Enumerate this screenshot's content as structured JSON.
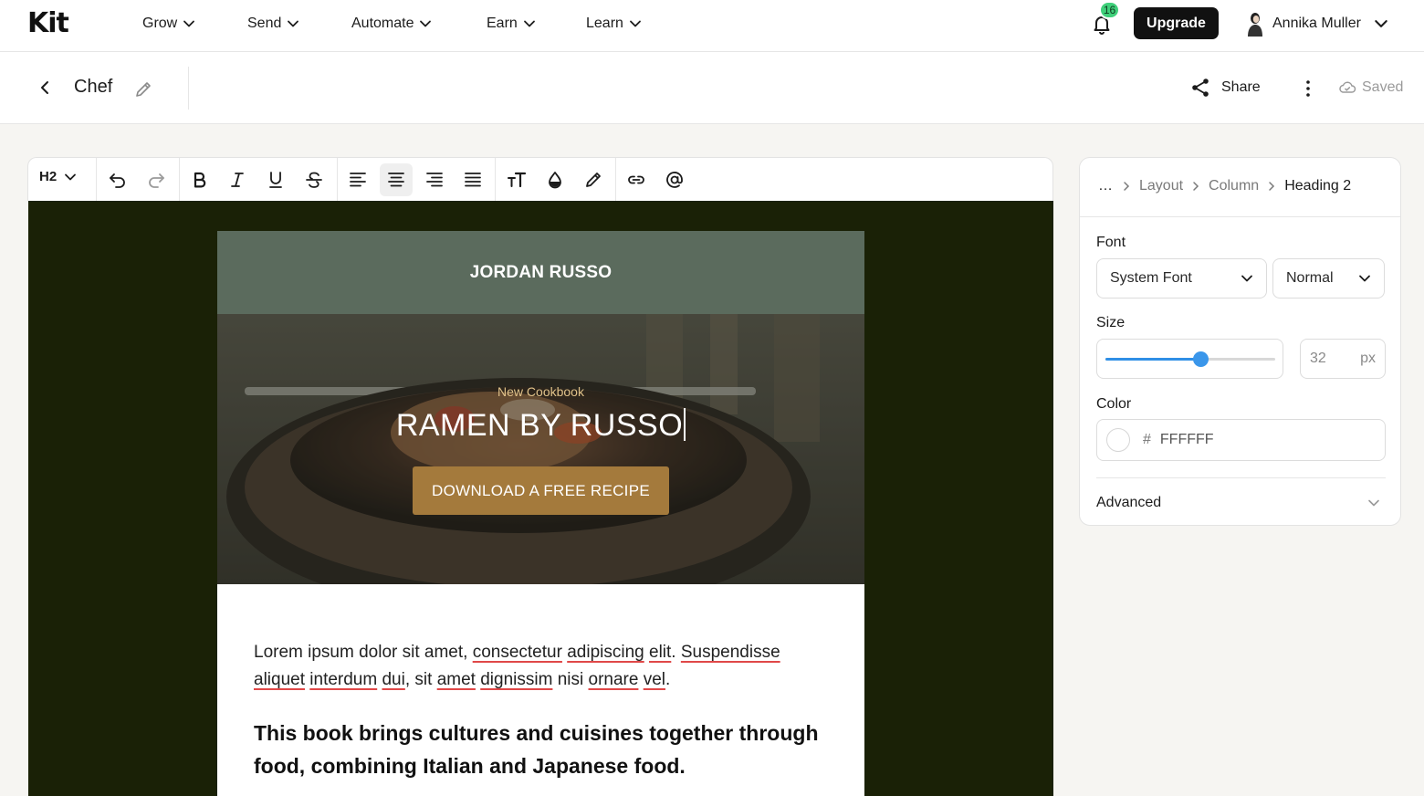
{
  "topnav": {
    "logo": "Kit",
    "items": [
      {
        "label": "Grow"
      },
      {
        "label": "Send"
      },
      {
        "label": "Automate"
      },
      {
        "label": "Earn"
      },
      {
        "label": "Learn"
      }
    ],
    "notifications_count": "16",
    "upgrade_label": "Upgrade",
    "user_name": "Annika Muller"
  },
  "subheader": {
    "title": "Chef",
    "share_label": "Share",
    "saved_label": "Saved"
  },
  "toolbar": {
    "heading_level": "H2",
    "buttons": [
      "undo-icon",
      "redo-icon",
      "bold-icon",
      "italic-icon",
      "underline-icon",
      "strikethrough-icon",
      "align-left-icon",
      "align-center-icon",
      "align-right-icon",
      "align-justify-icon",
      "text-size-icon",
      "text-color-icon",
      "highlight-icon",
      "link-icon",
      "mention-icon"
    ],
    "active_button": "align-center-icon"
  },
  "email": {
    "header_name": "JORDAN RUSSO",
    "hero_kicker": "New Cookbook",
    "hero_title": "RAMEN BY RUSSO",
    "hero_cta": "DOWNLOAD A FREE RECIPE",
    "para_parts": [
      {
        "t": "Lorem ipsum dolor sit amet, ",
        "s": false
      },
      {
        "t": "consectetur",
        "s": true
      },
      {
        "t": " ",
        "s": false
      },
      {
        "t": "adipiscing",
        "s": true
      },
      {
        "t": " ",
        "s": false
      },
      {
        "t": "elit",
        "s": true
      },
      {
        "t": ". ",
        "s": false
      },
      {
        "t": "Suspendisse",
        "s": true
      },
      {
        "t": " ",
        "s": false
      },
      {
        "t": "aliquet",
        "s": true
      },
      {
        "t": " ",
        "s": false
      },
      {
        "t": "interdum",
        "s": true
      },
      {
        "t": " ",
        "s": false
      },
      {
        "t": "dui",
        "s": true
      },
      {
        "t": ", sit ",
        "s": false
      },
      {
        "t": "amet",
        "s": true
      },
      {
        "t": " ",
        "s": false
      },
      {
        "t": "dignissim",
        "s": true
      },
      {
        "t": " nisi ",
        "s": false
      },
      {
        "t": "ornare",
        "s": true
      },
      {
        "t": " ",
        "s": false
      },
      {
        "t": "vel",
        "s": true
      },
      {
        "t": ".",
        "s": false
      }
    ],
    "bold_text": "This book brings cultures and cuisines together through food, combining Italian and Japanese food."
  },
  "panel": {
    "breadcrumb": [
      "…",
      "Layout",
      "Column",
      "Heading 2"
    ],
    "font_label": "Font",
    "font_family": "System Font",
    "font_weight": "Normal",
    "size_label": "Size",
    "size_value": "32",
    "size_unit": "px",
    "size_slider_fraction": 0.56,
    "color_label": "Color",
    "color_hash": "#",
    "color_value": "FFFFFF",
    "advanced_label": "Advanced"
  },
  "colors": {
    "canvas_bg": "#1a2106",
    "email_header_bg": "#5b6b5d",
    "cta_bg": "#a47a3c",
    "accent": "#3a96ea",
    "badge": "#3fd07a"
  }
}
